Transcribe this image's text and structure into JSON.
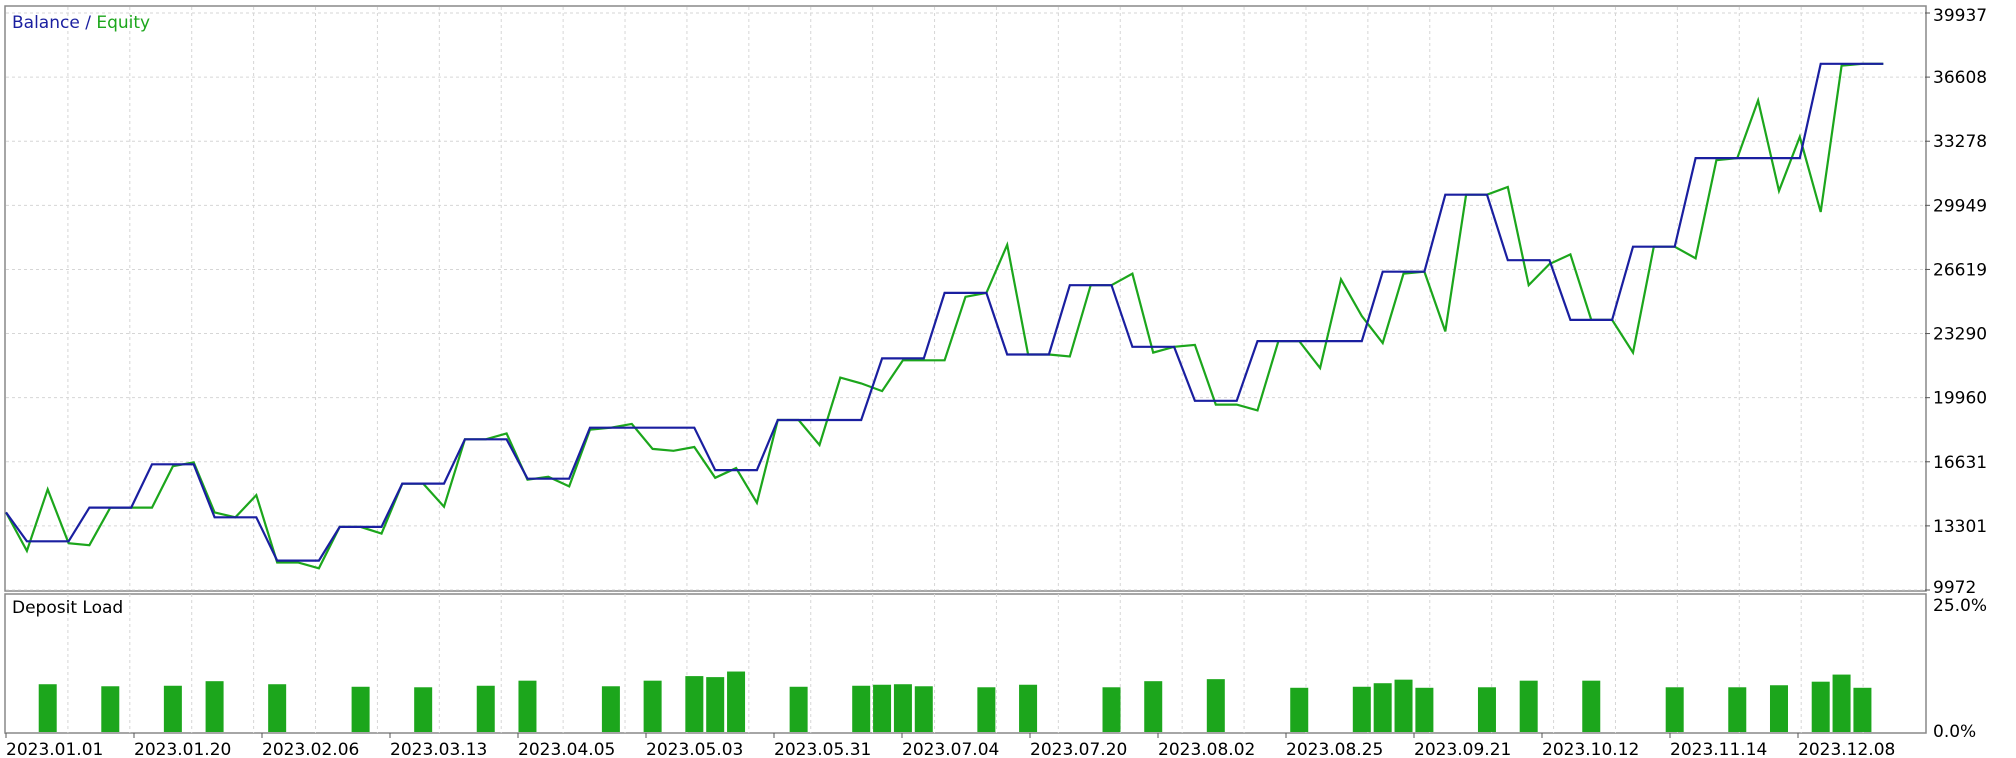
{
  "chart_data": [
    {
      "type": "line",
      "title": "Balance / Equity",
      "legend": [
        {
          "name": "Balance",
          "color": "#1a1fa0"
        },
        {
          "name": "Equity",
          "color": "#1ca61c"
        }
      ],
      "ylim": [
        9972,
        39937
      ],
      "y_ticks": [
        "39937",
        "36608",
        "33278",
        "29949",
        "26619",
        "23290",
        "19960",
        "16631",
        "13301",
        "9972"
      ],
      "x_tick_labels": [
        "2023.01.01",
        "2023.01.20",
        "2023.02.06",
        "2023.03.13",
        "2023.04.05",
        "2023.05.03",
        "2023.05.31",
        "2023.07.04",
        "2023.07.20",
        "2023.08.02",
        "2023.08.25",
        "2023.09.21",
        "2023.10.12",
        "2023.11.14",
        "2023.12.08"
      ],
      "x_count": 93,
      "grid": true,
      "series": [
        {
          "name": "Balance",
          "color": "#1a1fa0",
          "points": [
            [
              0,
              14000
            ],
            [
              1,
              12500
            ],
            [
              3,
              12500
            ],
            [
              4,
              14250
            ],
            [
              6,
              14250
            ],
            [
              7,
              16500
            ],
            [
              9,
              16500
            ],
            [
              10,
              13750
            ],
            [
              12,
              13750
            ],
            [
              13,
              11500
            ],
            [
              15,
              11500
            ],
            [
              16,
              13250
            ],
            [
              18,
              13250
            ],
            [
              19,
              15500
            ],
            [
              21,
              15500
            ],
            [
              22,
              17800
            ],
            [
              24,
              17800
            ],
            [
              25,
              15750
            ],
            [
              27,
              15750
            ],
            [
              28,
              18400
            ],
            [
              33,
              18400
            ],
            [
              34,
              16200
            ],
            [
              36,
              16200
            ],
            [
              37,
              18800
            ],
            [
              41,
              18800
            ],
            [
              42,
              22000
            ],
            [
              44,
              22000
            ],
            [
              45,
              25400
            ],
            [
              47,
              25400
            ],
            [
              48,
              22200
            ],
            [
              50,
              22200
            ],
            [
              51,
              25800
            ],
            [
              53,
              25800
            ],
            [
              54,
              22600
            ],
            [
              56,
              22600
            ],
            [
              57,
              19800
            ],
            [
              59,
              19800
            ],
            [
              60,
              22900
            ],
            [
              65,
              22900
            ],
            [
              66,
              26500
            ],
            [
              68,
              26500
            ],
            [
              69,
              30500
            ],
            [
              71,
              30500
            ],
            [
              72,
              27100
            ],
            [
              74,
              27100
            ],
            [
              75,
              24000
            ],
            [
              77,
              24000
            ],
            [
              78,
              27800
            ],
            [
              80,
              27800
            ],
            [
              81,
              32400
            ],
            [
              86,
              32400
            ],
            [
              87,
              37300
            ],
            [
              90,
              37300
            ]
          ]
        },
        {
          "name": "Equity",
          "color": "#1ca61c",
          "points": [
            [
              0,
              14000
            ],
            [
              1,
              12000
            ],
            [
              2,
              15200
            ],
            [
              3,
              12400
            ],
            [
              4,
              12300
            ],
            [
              5,
              14250
            ],
            [
              7,
              14250
            ],
            [
              8,
              16400
            ],
            [
              9,
              16600
            ],
            [
              10,
              14000
            ],
            [
              11,
              13750
            ],
            [
              12,
              14900
            ],
            [
              13,
              11400
            ],
            [
              14,
              11400
            ],
            [
              15,
              11100
            ],
            [
              16,
              13250
            ],
            [
              17,
              13250
            ],
            [
              18,
              12900
            ],
            [
              19,
              15500
            ],
            [
              20,
              15500
            ],
            [
              21,
              14300
            ],
            [
              22,
              17800
            ],
            [
              23,
              17800
            ],
            [
              24,
              18100
            ],
            [
              25,
              15700
            ],
            [
              26,
              15850
            ],
            [
              27,
              15350
            ],
            [
              28,
              18300
            ],
            [
              29,
              18400
            ],
            [
              30,
              18600
            ],
            [
              31,
              17300
            ],
            [
              32,
              17200
            ],
            [
              33,
              17400
            ],
            [
              34,
              15800
            ],
            [
              35,
              16300
            ],
            [
              36,
              14500
            ],
            [
              37,
              18800
            ],
            [
              38,
              18800
            ],
            [
              39,
              17500
            ],
            [
              40,
              21000
            ],
            [
              41,
              20700
            ],
            [
              42,
              20300
            ],
            [
              43,
              21900
            ],
            [
              44,
              21900
            ],
            [
              45,
              21900
            ],
            [
              46,
              25200
            ],
            [
              47,
              25400
            ],
            [
              48,
              27900
            ],
            [
              49,
              22200
            ],
            [
              50,
              22200
            ],
            [
              51,
              22100
            ],
            [
              52,
              25800
            ],
            [
              53,
              25800
            ],
            [
              54,
              26400
            ],
            [
              55,
              22300
            ],
            [
              56,
              22600
            ],
            [
              57,
              22700
            ],
            [
              58,
              19600
            ],
            [
              59,
              19600
            ],
            [
              60,
              19300
            ],
            [
              61,
              22900
            ],
            [
              62,
              22900
            ],
            [
              63,
              21500
            ],
            [
              64,
              26100
            ],
            [
              65,
              24200
            ],
            [
              66,
              22800
            ],
            [
              67,
              26400
            ],
            [
              68,
              26500
            ],
            [
              69,
              23400
            ],
            [
              70,
              30500
            ],
            [
              71,
              30500
            ],
            [
              72,
              30900
            ],
            [
              73,
              25800
            ],
            [
              74,
              26900
            ],
            [
              75,
              27400
            ],
            [
              76,
              24000
            ],
            [
              77,
              24000
            ],
            [
              78,
              22300
            ],
            [
              79,
              27800
            ],
            [
              80,
              27800
            ],
            [
              81,
              27200
            ],
            [
              82,
              32300
            ],
            [
              83,
              32400
            ],
            [
              84,
              35400
            ],
            [
              85,
              30700
            ],
            [
              86,
              33500
            ],
            [
              87,
              29600
            ],
            [
              88,
              37200
            ],
            [
              89,
              37300
            ],
            [
              90,
              37300
            ]
          ]
        }
      ]
    },
    {
      "type": "bar",
      "title": "Deposit Load",
      "ylim": [
        0,
        25
      ],
      "y_ticks": [
        "25.0%",
        "0.0%"
      ],
      "color": "#1ca61c",
      "bars": [
        [
          2,
          9.6
        ],
        [
          5,
          9.2
        ],
        [
          8,
          9.3
        ],
        [
          10,
          10.2
        ],
        [
          13,
          9.6
        ],
        [
          17,
          9.1
        ],
        [
          20,
          9.0
        ],
        [
          23,
          9.3
        ],
        [
          25,
          10.3
        ],
        [
          29,
          9.2
        ],
        [
          31,
          10.3
        ],
        [
          33,
          11.2
        ],
        [
          34,
          11.0
        ],
        [
          35,
          12.1
        ],
        [
          38,
          9.1
        ],
        [
          41,
          9.3
        ],
        [
          42,
          9.5
        ],
        [
          43,
          9.6
        ],
        [
          44,
          9.2
        ],
        [
          47,
          9.0
        ],
        [
          49,
          9.5
        ],
        [
          53,
          9.0
        ],
        [
          55,
          10.2
        ],
        [
          58,
          10.6
        ],
        [
          62,
          8.9
        ],
        [
          65,
          9.1
        ],
        [
          66,
          9.8
        ],
        [
          67,
          10.5
        ],
        [
          68,
          8.9
        ],
        [
          71,
          9.0
        ],
        [
          73,
          10.3
        ],
        [
          76,
          10.3
        ],
        [
          80,
          9.0
        ],
        [
          83,
          9.0
        ],
        [
          85,
          9.4
        ],
        [
          87,
          10.1
        ],
        [
          88,
          11.5
        ],
        [
          89,
          8.9
        ]
      ]
    }
  ]
}
